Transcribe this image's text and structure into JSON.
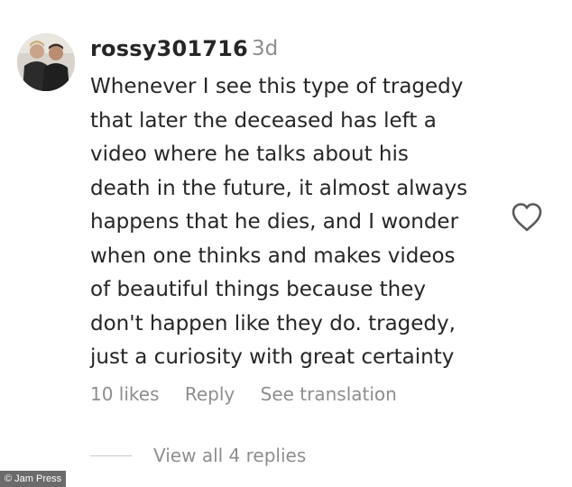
{
  "comment": {
    "username": "rossy301716",
    "time": "3d",
    "text_lines": [
      "Whenever I see this type of tragedy",
      "that later the deceased has left a",
      "video where he talks about his",
      "death in the future, it almost always",
      "happens that he dies, and I wonder",
      "when one thinks and makes videos",
      "of beautiful things because they",
      "don't happen like they do. tragedy,",
      "just a curiosity with great certainty"
    ],
    "likes": "10 likes",
    "reply_label": "Reply",
    "translate_label": "See translation",
    "view_replies": "View all 4 replies",
    "like_icon": "heart-outline-icon"
  },
  "watermark": "© Jam Press",
  "colors": {
    "primary_text": "#262626",
    "secondary_text": "#8e8e8e",
    "divider": "#c7c7c7",
    "watermark_bg": "#6b6b6b"
  }
}
